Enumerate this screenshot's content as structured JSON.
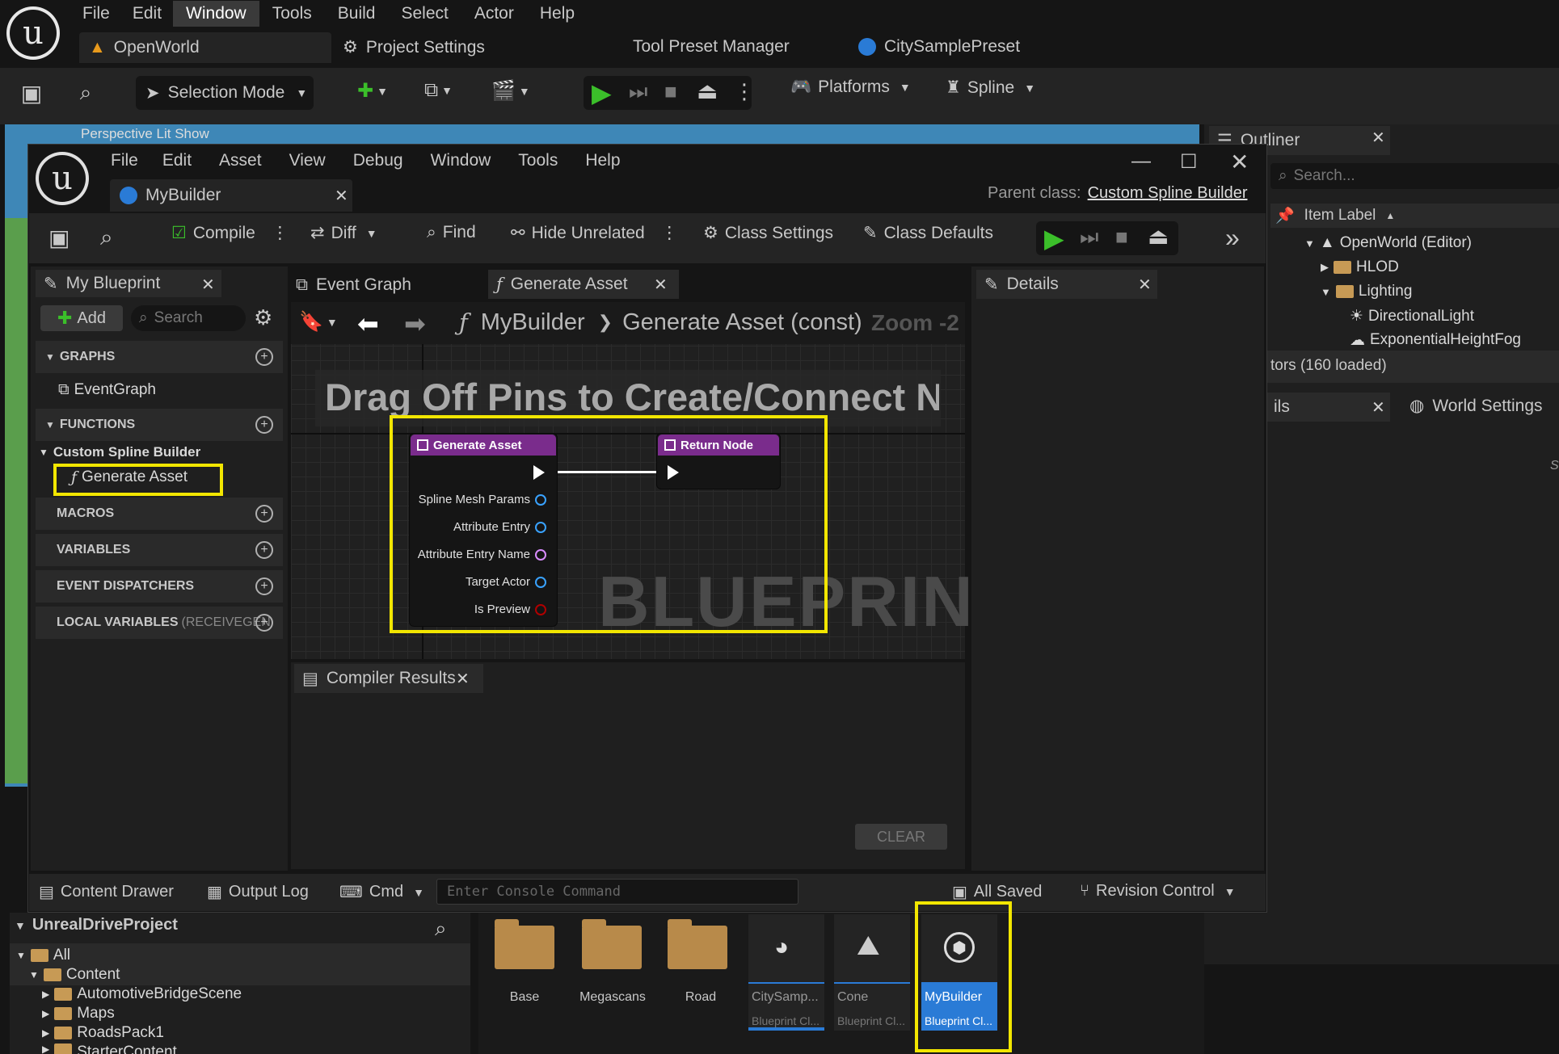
{
  "main_menu": {
    "items": [
      "File",
      "Edit",
      "Window",
      "Tools",
      "Build",
      "Select",
      "Actor",
      "Help"
    ],
    "active": "Window"
  },
  "top_tabs": {
    "level": "OpenWorld",
    "project_settings": "Project Settings",
    "tool_preset": "Tool Preset Manager",
    "city_preset": "CitySamplePreset"
  },
  "main_toolbar": {
    "selection_mode": "Selection Mode",
    "platforms": "Platforms",
    "spline": "Spline"
  },
  "viewport_strip": {
    "text": "Perspective  Lit  Show"
  },
  "outliner": {
    "title": "Outliner",
    "search_placeholder": "Search...",
    "column": "Item Label",
    "items": [
      "OpenWorld (Editor)",
      "HLOD",
      "Lighting",
      "DirectionalLight",
      "ExponentialHeightFog"
    ],
    "status": "tors (160 loaded)"
  },
  "right_tabs": {
    "details_partial": "ils",
    "world_settings": "World Settings"
  },
  "bp": {
    "menu": [
      "File",
      "Edit",
      "Asset",
      "View",
      "Debug",
      "Window",
      "Tools",
      "Help"
    ],
    "tab": "MyBuilder",
    "parent_label": "Parent class:",
    "parent_value": "Custom Spline Builder",
    "toolbar": {
      "compile": "Compile",
      "diff": "Diff",
      "find": "Find",
      "hide_unrelated": "Hide Unrelated",
      "class_settings": "Class Settings",
      "class_defaults": "Class Defaults"
    },
    "my_blueprint": {
      "title": "My Blueprint",
      "add": "Add",
      "search_placeholder": "Search",
      "graphs": "GRAPHS",
      "event_graph": "EventGraph",
      "functions": "FUNCTIONS",
      "category": "Custom Spline Builder",
      "function": "Generate Asset",
      "macros": "MACROS",
      "variables": "VARIABLES",
      "dispatchers": "EVENT DISPATCHERS",
      "local_vars": "LOCAL VARIABLES",
      "local_vars_suffix": "(RECEIVEGEN"
    },
    "graph_tabs": {
      "event_graph": "Event Graph",
      "generate_asset": "Generate Asset"
    },
    "breadcrumb": {
      "root": "MyBuilder",
      "leaf": "Generate Asset (const)",
      "zoom": "Zoom -2"
    },
    "banner": "Drag Off Pins to Create/Connect New N",
    "watermark": "BLUEPRINT",
    "node_entry": {
      "title": "Generate Asset",
      "pins": [
        "Spline Mesh Params",
        "Attribute Entry",
        "Attribute Entry Name",
        "Target Actor",
        "Is Preview"
      ]
    },
    "node_return": {
      "title": "Return Node"
    },
    "details": {
      "title": "Details"
    },
    "compiler": {
      "title": "Compiler Results",
      "clear": "CLEAR"
    },
    "status_bar": {
      "content_drawer": "Content Drawer",
      "output_log": "Output Log",
      "cmd": "Cmd",
      "console_placeholder": "Enter Console Command",
      "all_saved": "All Saved",
      "revision": "Revision Control"
    }
  },
  "content_browser": {
    "project": "UnrealDriveProject",
    "tree": [
      "All",
      "Content",
      "AutomotiveBridgeScene",
      "Maps",
      "RoadsPack1",
      "StarterContent"
    ],
    "folders": [
      "Base",
      "Megascans",
      "Road"
    ],
    "assets": [
      {
        "name": "CitySamp...",
        "type": "Blueprint Cl..."
      },
      {
        "name": "Cone",
        "type": "Blueprint Cl..."
      },
      {
        "name": "MyBuilder",
        "type": "Blueprint Cl..."
      }
    ],
    "truncated": "S"
  },
  "colors": {
    "accent_blue": "#2a7bd6",
    "highlight": "#f2e600",
    "node_purple": "#7a2c8c",
    "play_green": "#3bbf2a"
  }
}
